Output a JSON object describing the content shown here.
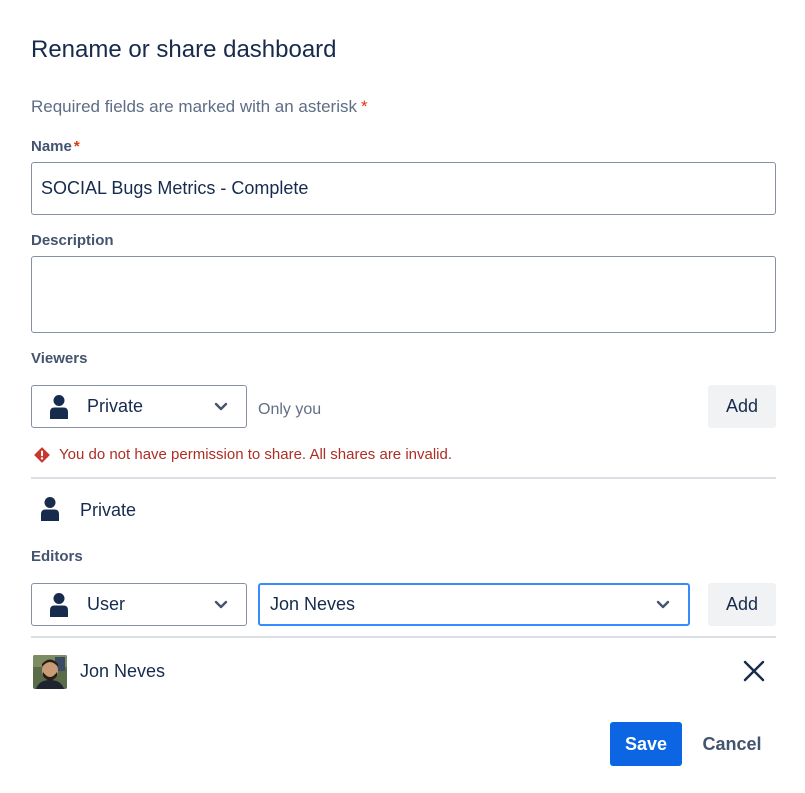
{
  "dialog": {
    "title": "Rename or share dashboard",
    "required_note": "Required fields are marked with an asterisk",
    "asterisk": "*"
  },
  "name_field": {
    "label": "Name",
    "value": "SOCIAL Bugs Metrics - Complete"
  },
  "description_field": {
    "label": "Description",
    "value": ""
  },
  "viewers": {
    "label": "Viewers",
    "select_value": "Private",
    "hint": "Only you",
    "add_label": "Add",
    "error": "You do not have permission to share. All shares are invalid.",
    "entries": [
      {
        "label": "Private",
        "icon": "person-icon"
      }
    ]
  },
  "editors": {
    "label": "Editors",
    "select_value": "User",
    "user_search_value": "Jon Neves",
    "add_label": "Add",
    "entries": [
      {
        "name": "Jon Neves",
        "icon": "avatar"
      }
    ]
  },
  "footer": {
    "save_label": "Save",
    "cancel_label": "Cancel"
  },
  "colors": {
    "primary": "#0c66e4",
    "error": "#ae2e24",
    "focus": "#388bff",
    "text": "#172b4d"
  }
}
